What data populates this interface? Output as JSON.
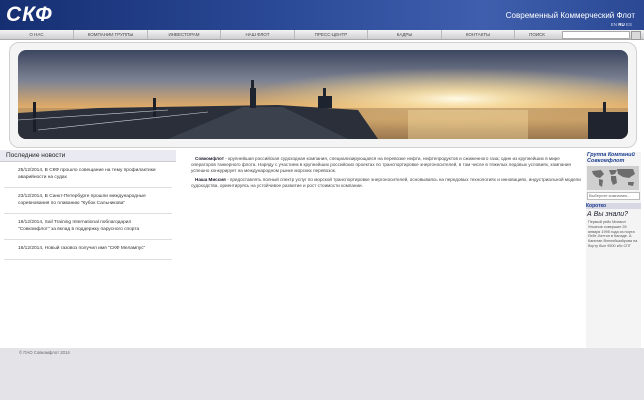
{
  "header": {
    "logo": "СКФ",
    "tagline": "Современный Коммерческий Флот",
    "languages": [
      "EN",
      "RU",
      "ES"
    ],
    "active_language": "RU"
  },
  "nav": {
    "items": [
      "О НАС",
      "КОМПАНИИ ГРУППЫ",
      "ИНВЕСТОРАМ",
      "НАШ ФЛОТ",
      "ПРЕСС-ЦЕНТР",
      "КАДРЫ",
      "КОНТАКТЫ",
      "ПОИСК"
    ]
  },
  "news": {
    "title": "Последние новости",
    "items": [
      "25/12/2014, В СКФ прошло совещание на тему профилактики аварийности на судах",
      "23/12/2014, В Санкт-Петербурге прошли международные соревнования по плаванию \"Кубок Сальникова\"",
      "18/12/2014, Sail Training International поблагодарил \"Совкомфлот\" за вклад в поддержку парусного спорта",
      "16/12/2014, Новый газовоз получил имя \"СКФ Мелампус\""
    ]
  },
  "about": {
    "p1_lead": "Совкомфлот",
    "p1_text": " - крупнейшая российская судоходная компания, специализирующаяся на перевозке нефти, нефтепродуктов и сжиженного газа; один из крупнейших в мире операторов танкерного флота. Наряду с участием в крупнейших российских проектах по транспортировке энергоносителей, в том числе в тяжелых ледовых условиях, компания успешно конкурирует на международном рынке морских перевозок.",
    "p2_lead": "Наша Миссия",
    "p2_text": " - предоставлять полный спектр услуг по морской транспортировке энергоносителей, основываясь на передовых технологиях и инновациях, индустриальной модели судоходства, ориентируясь на устойчивое развитие и рост стоимости компании."
  },
  "sidebar": {
    "group_title": "Группа Компаний Совкомфлот",
    "select_placeholder": "Выберите компанию...",
    "briefly_label": "Коротко",
    "did_you_know": "А Вы знали?",
    "fact": "Первый рейс Михаил Ульянов совершил 26 января 1995 года из порта Лейт-Хаттон в Канаде. А Капитан Вэплийшийрова на борту был 9500 кбс СПГ"
  },
  "footer": {
    "copyright": "© ПАО Совкомфлот 2014"
  }
}
